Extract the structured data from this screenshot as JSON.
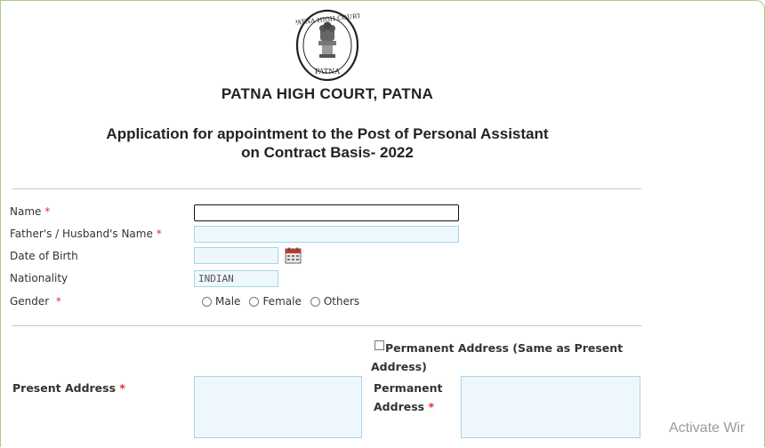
{
  "header": {
    "emblem": {
      "icon": "patna-high-court-emblem",
      "seal_text_top": "PATNA HIGH COURT",
      "seal_text_bottom": "PATNA"
    },
    "court_name": "PATNA HIGH COURT, PATNA",
    "application_title_line1": "Application for appointment to the Post of Personal Assistant",
    "application_title_line2": "on Contract Basis- 2022"
  },
  "form": {
    "name": {
      "label": "Name",
      "required": "*",
      "value": ""
    },
    "father_husband_name": {
      "label": "Father's / Husband's Name",
      "required": "*",
      "value": ""
    },
    "dob": {
      "label": "Date of Birth",
      "value": "",
      "icon": "calendar-icon"
    },
    "nationality": {
      "label": "Nationality",
      "value": "INDIAN"
    },
    "gender": {
      "label": "Gender",
      "required": "*",
      "options": [
        "Male",
        "Female",
        "Others"
      ]
    },
    "permanent_same": {
      "label_line1": "Permanent Address (Same as Present",
      "label_line2": "Address)",
      "checked": false
    },
    "present_address": {
      "label": "Present Address",
      "required": "*",
      "value": ""
    },
    "permanent_address": {
      "label_line1": "Permanent",
      "label_line2": "Address",
      "required": "*",
      "value": ""
    }
  },
  "watermark": "Activate Wir",
  "colors": {
    "required": "#e0312e",
    "input_bg": "#eef8fc",
    "input_border": "#a9d5e8",
    "frame": "#a9c98a"
  }
}
